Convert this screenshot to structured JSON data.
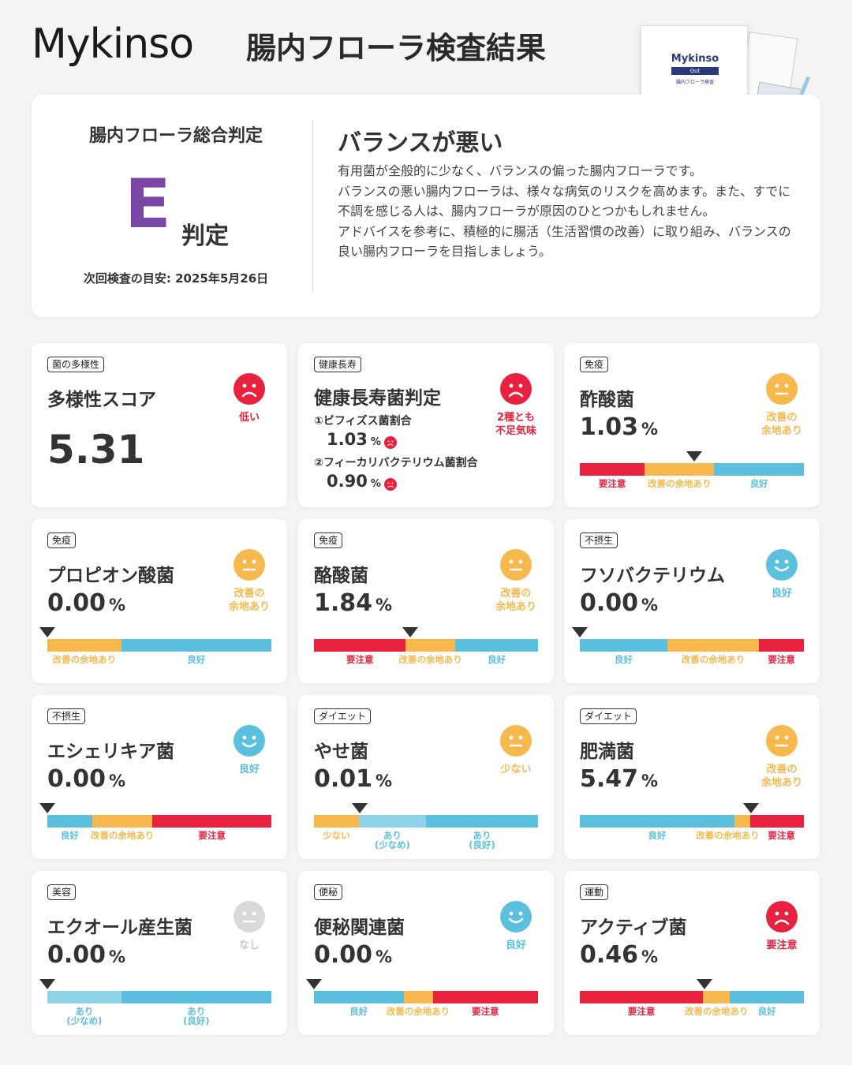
{
  "header": {
    "brand": "Mykinso",
    "title": "腸内フローラ検査結果"
  },
  "kit": {
    "brand": "Mykinso",
    "band": "Gut",
    "subtitle": "腸内フローラ検査"
  },
  "summary": {
    "label": "腸内フローラ総合判定",
    "grade": "E",
    "grade_suffix": "判定",
    "next_exam": "次回検査の目安: 2025年5月26日",
    "verdict": "バランスが悪い",
    "description": "有用菌が全般的に少なく、バランスの偏った腸内フローラです。\nバランスの悪い腸内フローラは、様々な病気のリスクを高めます。また、すでに不調を感じる人は、腸内フローラが原因のひとつかもしれません。\nアドバイスを参考に、積極的に腸活（生活習慣の改善）に取り組み、バランスの良い腸内フローラを目指しましょう。"
  },
  "colors": {
    "red": "#e8213f",
    "orange": "#f7b84e",
    "blue": "#5bbfde",
    "lightblue": "#8fd3ea",
    "grey": "#cccccc",
    "purple": "#7b47a6"
  },
  "cards": [
    {
      "tag": "菌の多様性",
      "title": "多様性スコア",
      "value": "5.31",
      "mood": "sad",
      "status": "低い",
      "status_color": "red"
    },
    {
      "tag": "健康長寿",
      "title": "健康長寿菌判定",
      "mood": "sad",
      "status": "2種とも\n不足気味",
      "status_color": "red",
      "subs": [
        {
          "label": "①ビフィズス菌割合",
          "value": "1.03",
          "unit": "%",
          "mood": "sad"
        },
        {
          "label": "②フィーカリバクテリウム菌割合",
          "value": "0.90",
          "unit": "%",
          "mood": "sad"
        }
      ]
    },
    {
      "tag": "免疫",
      "title": "酢酸菌",
      "value": "1.03",
      "unit": "%",
      "mood": "neutral",
      "status": "改善の\n余地あり",
      "status_color": "orange",
      "pointer_pct": 51,
      "segments": [
        {
          "color": "red",
          "width_pct": 29
        },
        {
          "color": "orange",
          "width_pct": 31
        },
        {
          "color": "blue",
          "width_pct": 40
        }
      ],
      "labels": [
        {
          "text": "要注意",
          "color": "red",
          "center_pct": 14.5
        },
        {
          "text": "改善の余地あり",
          "color": "orange",
          "center_pct": 44.5
        },
        {
          "text": "良好",
          "color": "blue",
          "center_pct": 80
        }
      ]
    },
    {
      "tag": "免疫",
      "title": "プロピオン酸菌",
      "value": "0.00",
      "unit": "%",
      "mood": "neutral",
      "status": "改善の\n余地あり",
      "status_color": "orange",
      "pointer_pct": 0,
      "segments": [
        {
          "color": "orange",
          "width_pct": 33
        },
        {
          "color": "blue",
          "width_pct": 67
        }
      ],
      "labels": [
        {
          "text": "改善の余地あり",
          "color": "orange",
          "center_pct": 16.5
        },
        {
          "text": "良好",
          "color": "blue",
          "center_pct": 66.5
        }
      ]
    },
    {
      "tag": "免疫",
      "title": "酪酸菌",
      "value": "1.84",
      "unit": "%",
      "mood": "neutral",
      "status": "改善の\n余地あり",
      "status_color": "orange",
      "pointer_pct": 43,
      "segments": [
        {
          "color": "red",
          "width_pct": 41
        },
        {
          "color": "orange",
          "width_pct": 22
        },
        {
          "color": "blue",
          "width_pct": 37
        }
      ],
      "labels": [
        {
          "text": "要注意",
          "color": "red",
          "center_pct": 20.5
        },
        {
          "text": "改善の余地あり",
          "color": "orange",
          "center_pct": 52
        },
        {
          "text": "良好",
          "color": "blue",
          "center_pct": 81.5
        }
      ]
    },
    {
      "tag": "不摂生",
      "title": "フソバクテリウム",
      "value": "0.00",
      "unit": "%",
      "mood": "happy",
      "status": "良好",
      "status_color": "blue",
      "pointer_pct": 0,
      "segments": [
        {
          "color": "blue",
          "width_pct": 39
        },
        {
          "color": "orange",
          "width_pct": 41
        },
        {
          "color": "red",
          "width_pct": 20
        }
      ],
      "labels": [
        {
          "text": "良好",
          "color": "blue",
          "center_pct": 19.5
        },
        {
          "text": "改善の余地あり",
          "color": "orange",
          "center_pct": 59.5
        },
        {
          "text": "要注意",
          "color": "red",
          "center_pct": 90
        }
      ]
    },
    {
      "tag": "不摂生",
      "title": "エシェリキア菌",
      "value": "0.00",
      "unit": "%",
      "mood": "happy",
      "status": "良好",
      "status_color": "blue",
      "pointer_pct": 0,
      "segments": [
        {
          "color": "blue",
          "width_pct": 20
        },
        {
          "color": "orange",
          "width_pct": 27
        },
        {
          "color": "red",
          "width_pct": 53
        }
      ],
      "labels": [
        {
          "text": "良好",
          "color": "blue",
          "center_pct": 10
        },
        {
          "text": "改善の余地あり",
          "color": "orange",
          "center_pct": 33.5
        },
        {
          "text": "要注意",
          "color": "red",
          "center_pct": 73.5
        }
      ]
    },
    {
      "tag": "ダイエット",
      "title": "やせ菌",
      "value": "0.01",
      "unit": "%",
      "mood": "neutral",
      "status": "少ない",
      "status_color": "orange",
      "pointer_pct": 20.5,
      "segments": [
        {
          "color": "orange",
          "width_pct": 20
        },
        {
          "color": "lightblue",
          "width_pct": 30
        },
        {
          "color": "blue",
          "width_pct": 50
        }
      ],
      "labels": [
        {
          "text": "少ない",
          "color": "orange",
          "center_pct": 10
        },
        {
          "text": "あり\n(少なめ)",
          "color": "blue",
          "center_pct": 35
        },
        {
          "text": "あり\n(良好)",
          "color": "blue",
          "center_pct": 75
        }
      ]
    },
    {
      "tag": "ダイエット",
      "title": "肥満菌",
      "value": "5.47",
      "unit": "%",
      "mood": "neutral",
      "status": "改善の\n余地あり",
      "status_color": "orange",
      "pointer_pct": 76.5,
      "segments": [
        {
          "color": "blue",
          "width_pct": 69
        },
        {
          "color": "orange",
          "width_pct": 7
        },
        {
          "color": "red",
          "width_pct": 24
        }
      ],
      "labels": [
        {
          "text": "良好",
          "color": "blue",
          "center_pct": 34.5
        },
        {
          "text": "改善の余地あり",
          "color": "orange",
          "center_pct": 66
        },
        {
          "text": "要注意",
          "color": "red",
          "center_pct": 90
        }
      ]
    },
    {
      "tag": "美容",
      "title": "エクオール産生菌",
      "value": "0.00",
      "unit": "%",
      "mood": "neutral",
      "status": "なし",
      "status_color": "grey",
      "pointer_pct": 0,
      "segments": [
        {
          "color": "lightblue",
          "width_pct": 33
        },
        {
          "color": "blue",
          "width_pct": 67
        }
      ],
      "labels": [
        {
          "text": "あり\n(少なめ)",
          "color": "blue",
          "center_pct": 16.5
        },
        {
          "text": "あり\n(良好)",
          "color": "blue",
          "center_pct": 66.5
        }
      ]
    },
    {
      "tag": "便秘",
      "title": "便秘関連菌",
      "value": "0.00",
      "unit": "%",
      "mood": "happy",
      "status": "良好",
      "status_color": "blue",
      "pointer_pct": 0,
      "segments": [
        {
          "color": "blue",
          "width_pct": 40
        },
        {
          "color": "orange",
          "width_pct": 13
        },
        {
          "color": "red",
          "width_pct": 47
        }
      ],
      "labels": [
        {
          "text": "良好",
          "color": "blue",
          "center_pct": 20
        },
        {
          "text": "改善の余地あり",
          "color": "orange",
          "center_pct": 46.5
        },
        {
          "text": "要注意",
          "color": "red",
          "center_pct": 76.5
        }
      ]
    },
    {
      "tag": "運動",
      "title": "アクティブ菌",
      "value": "0.46",
      "unit": "%",
      "mood": "sad",
      "status": "要注意",
      "status_color": "red",
      "pointer_pct": 55.5,
      "segments": [
        {
          "color": "red",
          "width_pct": 55
        },
        {
          "color": "orange",
          "width_pct": 12
        },
        {
          "color": "blue",
          "width_pct": 33
        }
      ],
      "labels": [
        {
          "text": "要注意",
          "color": "red",
          "center_pct": 27.5
        },
        {
          "text": "改善の余地あり",
          "color": "orange",
          "center_pct": 61
        },
        {
          "text": "良好",
          "color": "blue",
          "center_pct": 83.5
        }
      ]
    }
  ]
}
